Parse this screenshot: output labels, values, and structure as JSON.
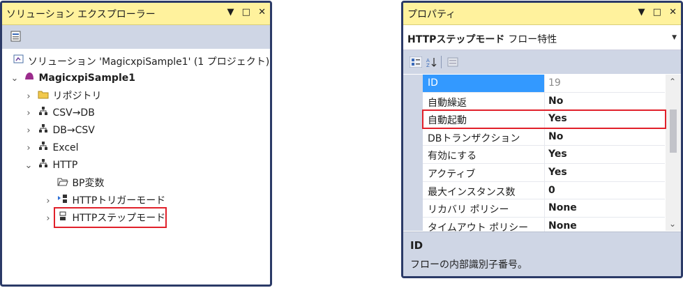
{
  "solution_explorer": {
    "title": "ソリューション エクスプローラー",
    "window_buttons": {
      "dropdown": "▼",
      "maximize": "□",
      "close": "✕"
    },
    "toolbar_icon": "properties-page-icon",
    "tree": {
      "solution_label": "ソリューション 'MagicxpiSample1' (1 プロジェクト)",
      "project_label": "MagicxpiSample1",
      "items": [
        {
          "label": "リポジトリ",
          "icon": "folder-icon",
          "arrow": "›"
        },
        {
          "label": "CSV→DB",
          "icon": "flow-icon",
          "arrow": "›"
        },
        {
          "label": "DB→CSV",
          "icon": "flow-icon",
          "arrow": "›"
        },
        {
          "label": "Excel",
          "icon": "flow-icon",
          "arrow": "›"
        },
        {
          "label": "HTTP",
          "icon": "flow-icon",
          "arrow": "⌄"
        }
      ],
      "http_children": [
        {
          "label": "BP変数",
          "icon": "open-folder-icon",
          "arrow": ""
        },
        {
          "label": "HTTPトリガーモード",
          "icon": "trigger-flow-icon",
          "arrow": "›"
        },
        {
          "label": "HTTPステップモード",
          "icon": "step-flow-icon",
          "arrow": "›"
        }
      ]
    },
    "highlight_color": "#e1202a"
  },
  "properties": {
    "title": "プロパティ",
    "window_buttons": {
      "dropdown": "▼",
      "maximize": "□",
      "close": "✕"
    },
    "selector": {
      "name": "HTTPステップモード",
      "type": "フロー特性"
    },
    "rows": [
      {
        "name": "ID",
        "value": "19",
        "selected": true
      },
      {
        "name": "自動繰返",
        "value": "No"
      },
      {
        "name": "自動起動",
        "value": "Yes",
        "highlighted": true
      },
      {
        "name": "DBトランザクション",
        "value": "No"
      },
      {
        "name": "有効にする",
        "value": "Yes"
      },
      {
        "name": "アクティブ",
        "value": "Yes"
      },
      {
        "name": "最大インスタンス数",
        "value": "0"
      },
      {
        "name": "リカバリ ポリシー",
        "value": "None"
      },
      {
        "name": "タイムアウト ポリシー",
        "value": "None"
      }
    ],
    "description": {
      "title": "ID",
      "text": "フローの内部識別子番号。"
    },
    "selection_color": "#3399ff"
  }
}
